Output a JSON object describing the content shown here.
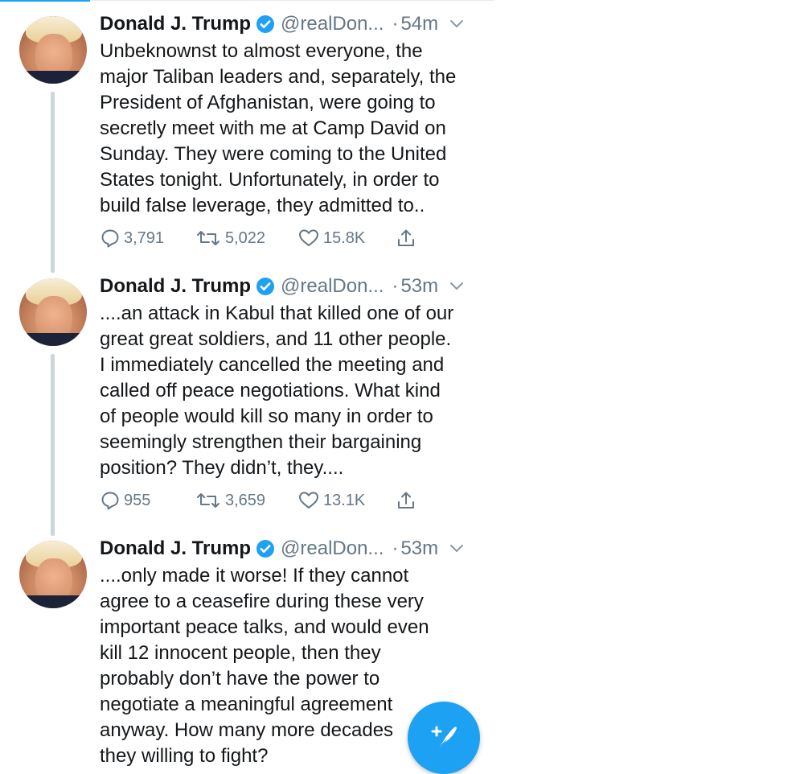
{
  "tweets": [
    {
      "author_name": "Donald J. Trump",
      "handle": "@realDon...",
      "time": "54m",
      "text": "Unbeknownst to almost everyone, the\nmajor Taliban leaders and, separately, the\nPresident of Afghanistan, were going to\nsecretly meet with me at Camp David on\nSunday. They were coming to the United\nStates tonight. Unfortunately, in order to\nbuild false leverage, they admitted to..",
      "replies": "3,791",
      "retweets": "5,022",
      "likes": "15.8K"
    },
    {
      "author_name": "Donald J. Trump",
      "handle": "@realDon...",
      "time": "53m",
      "text": "....an attack in Kabul that killed one of our\ngreat great soldiers, and 11 other people.\nI immediately cancelled the meeting and\ncalled off peace negotiations. What kind\nof people would kill so many in order to\nseemingly strengthen their bargaining\nposition? They didn’t, they....",
      "replies": "955",
      "retweets": "3,659",
      "likes": "13.1K"
    },
    {
      "author_name": "Donald J. Trump",
      "handle": "@realDon...",
      "time": "53m",
      "text": "....only made it worse! If they cannot\nagree to a ceasefire during these very\nimportant peace talks, and would even\nkill 12 innocent people, then they\nprobably don’t have the power to\nnegotiate a meaningful agreement\nanyway. How many more decades\nthey willing to fight?"
    }
  ],
  "separator": "·",
  "icons": {
    "verified": "verified-badge-icon",
    "caret": "chevron-down-icon",
    "reply": "reply-icon",
    "retweet": "retweet-icon",
    "like": "heart-icon",
    "share": "share-icon",
    "compose": "compose-tweet-icon"
  },
  "colors": {
    "accent": "#1da1f2",
    "text": "#14171a",
    "secondary": "#657786",
    "thread_line": "#ccd6dd"
  }
}
